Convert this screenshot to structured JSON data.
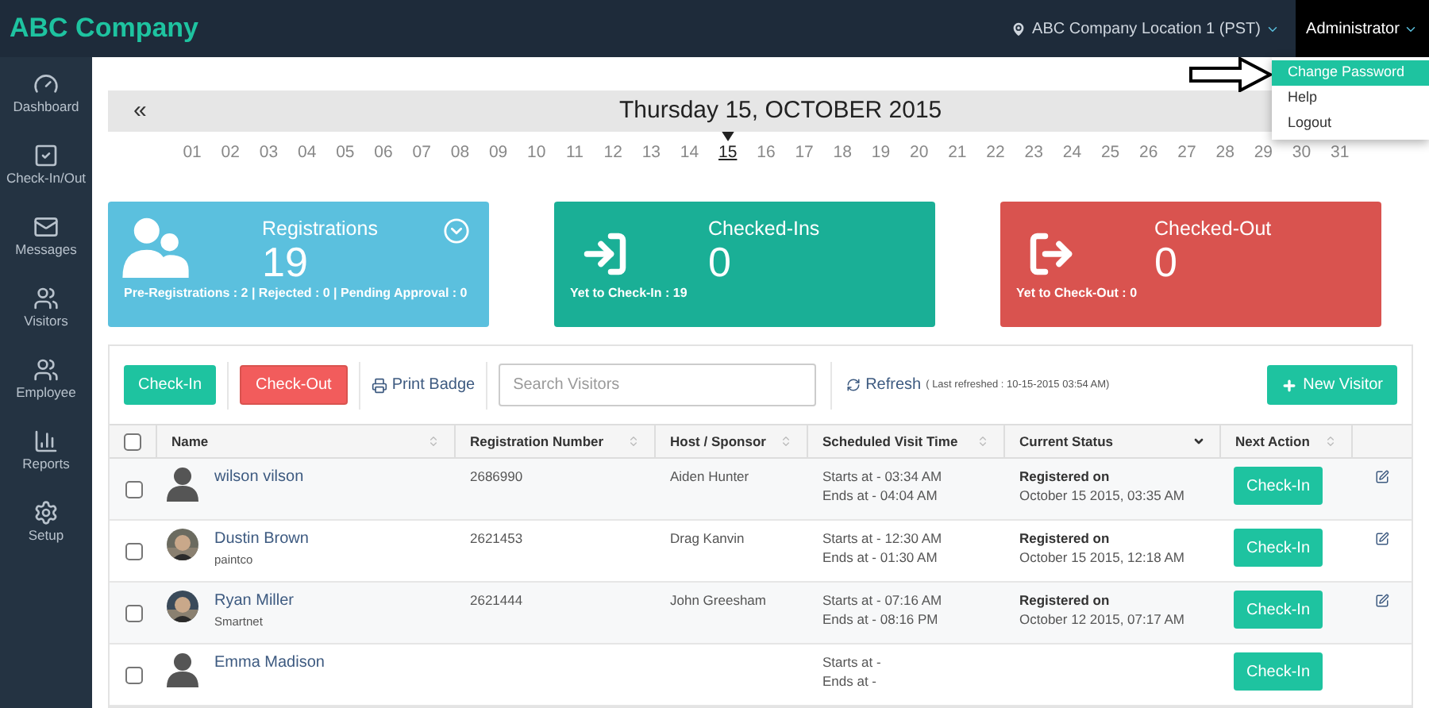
{
  "header": {
    "brand": "ABC Company",
    "location": "ABC Company Location 1 (PST)",
    "user": "Administrator"
  },
  "user_menu": [
    {
      "label": "Change Password",
      "selected": true
    },
    {
      "label": "Help",
      "selected": false
    },
    {
      "label": "Logout",
      "selected": false
    }
  ],
  "sidebar": [
    {
      "kind": "dashboard",
      "label": "Dashboard"
    },
    {
      "kind": "checkinout",
      "label": "Check-In/Out"
    },
    {
      "kind": "messages",
      "label": "Messages"
    },
    {
      "kind": "visitors",
      "label": "Visitors"
    },
    {
      "kind": "employee",
      "label": "Employee"
    },
    {
      "kind": "reports",
      "label": "Reports"
    },
    {
      "kind": "setup",
      "label": "Setup"
    }
  ],
  "date_bar": {
    "prev": "«",
    "title": "Thursday 15, OCTOBER 2015"
  },
  "days": [
    {
      "label": "01",
      "selected": false
    },
    {
      "label": "02",
      "selected": false
    },
    {
      "label": "03",
      "selected": false
    },
    {
      "label": "04",
      "selected": false
    },
    {
      "label": "05",
      "selected": false
    },
    {
      "label": "06",
      "selected": false
    },
    {
      "label": "07",
      "selected": false
    },
    {
      "label": "08",
      "selected": false
    },
    {
      "label": "09",
      "selected": false
    },
    {
      "label": "10",
      "selected": false
    },
    {
      "label": "11",
      "selected": false
    },
    {
      "label": "12",
      "selected": false
    },
    {
      "label": "13",
      "selected": false
    },
    {
      "label": "14",
      "selected": false
    },
    {
      "label": "15",
      "selected": true
    },
    {
      "label": "16",
      "selected": false
    },
    {
      "label": "17",
      "selected": false
    },
    {
      "label": "18",
      "selected": false
    },
    {
      "label": "19",
      "selected": false
    },
    {
      "label": "20",
      "selected": false
    },
    {
      "label": "21",
      "selected": false
    },
    {
      "label": "22",
      "selected": false
    },
    {
      "label": "23",
      "selected": false
    },
    {
      "label": "24",
      "selected": false
    },
    {
      "label": "25",
      "selected": false
    },
    {
      "label": "26",
      "selected": false
    },
    {
      "label": "27",
      "selected": false
    },
    {
      "label": "28",
      "selected": false
    },
    {
      "label": "29",
      "selected": false
    },
    {
      "label": "30",
      "selected": false
    },
    {
      "label": "31",
      "selected": false
    }
  ],
  "cards": [
    {
      "kind": "registrations",
      "color": "#5bc0de",
      "title": "Registrations",
      "count": "19",
      "footer": "Pre-Registrations : 2 | Rejected : 0 | Pending Approval : 0"
    },
    {
      "kind": "checkins",
      "color": "#1aaf96",
      "title": "Checked-Ins",
      "count": "0",
      "footer": "Yet to Check-In : 19"
    },
    {
      "kind": "checkouts",
      "color": "#d9534f",
      "title": "Checked-Out",
      "count": "0",
      "footer": "Yet to Check-Out : 0"
    }
  ],
  "toolbar": {
    "check_in": "Check-In",
    "check_out": "Check-Out",
    "print": "Print Badge",
    "search_placeholder": "Search Visitors",
    "refresh": "Refresh",
    "last_refreshed": "( Last refreshed : 10-15-2015 03:54 AM)",
    "new_visitor": "New Visitor"
  },
  "table": {
    "select_all_checked": false,
    "columns": [
      {
        "label": "Name",
        "kind": "sortable"
      },
      {
        "label": "Registration Number",
        "kind": "sortable"
      },
      {
        "label": "Host / Sponsor",
        "kind": "sortable"
      },
      {
        "label": "Scheduled Visit Time",
        "kind": "sortable"
      },
      {
        "label": "Current Status",
        "kind": "sorted"
      },
      {
        "label": "Next Action",
        "kind": "sortable"
      }
    ],
    "rows": [
      {
        "checked": false,
        "avatar": {
          "kind": "silhouette"
        },
        "name": "wilson vilson",
        "company": "",
        "reg": "2686990",
        "host": "Aiden Hunter",
        "starts": "Starts at - 03:34 AM",
        "ends": "Ends at - 04:04 AM",
        "status": "Registered on",
        "status_date": "October 15 2015, 03:35 AM",
        "action": "Check-In",
        "editable": true
      },
      {
        "checked": false,
        "name": "Dustin Brown",
        "company": "paintco",
        "reg": "2621453",
        "host": "Drag Kanvin",
        "starts": "Starts at - 12:30 AM",
        "ends": "Ends at - 01:30 AM",
        "status": "Registered on",
        "status_date": "October 15 2015, 12:18 AM",
        "action": "Check-In",
        "editable": true
      },
      {
        "checked": false,
        "name": "Ryan Miller",
        "company": "Smartnet",
        "reg": "2621444",
        "host": "John Greesham",
        "starts": "Starts at - 07:16 AM",
        "ends": "Ends at - 08:16 PM",
        "status": "Registered on",
        "status_date": "October 12 2015, 07:17 AM",
        "action": "Check-In",
        "editable": true
      },
      {
        "checked": false,
        "avatar": {
          "kind": "silhouette"
        },
        "name": "Emma Madison",
        "company": "",
        "reg": "",
        "host": "",
        "starts": "Starts at -",
        "ends": "Ends at -",
        "status": "",
        "status_date": "",
        "action": "Check-In",
        "editable": false
      }
    ]
  }
}
